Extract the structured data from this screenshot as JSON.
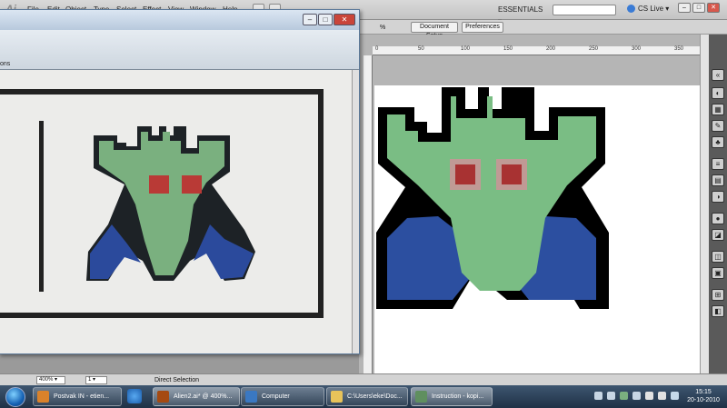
{
  "menubar": {
    "app_logo": "Ai",
    "items": [
      "File",
      "Edit",
      "Object",
      "Type",
      "Select",
      "Effect",
      "View",
      "Window",
      "Help"
    ],
    "workspace": "ESSENTIALS",
    "cs_live": "CS Live"
  },
  "control_bar": {
    "percent_label": "%",
    "document_setup": "Document Setup",
    "preferences": "Preferences"
  },
  "ruler": {
    "ticks": [
      "0",
      "50",
      "100",
      "150",
      "200",
      "250",
      "300",
      "350"
    ]
  },
  "reference_window": {
    "toolbar_label": "ons",
    "close_label": "✕"
  },
  "status_bar": {
    "zoom": "400%",
    "artboard_number": "1",
    "tool": "Direct Selection"
  },
  "taskbar": {
    "tasks": [
      {
        "label": "Postvak IN - etien...",
        "color": "#d9822b"
      },
      {
        "label": "Alien2.ai* @ 400%...",
        "color": "#a54a12"
      },
      {
        "label": "Computer",
        "color": "#3a78c2"
      },
      {
        "label": "C:\\Users\\eke\\Doc...",
        "color": "#e8c35a"
      },
      {
        "label": "Instruction - kopi...",
        "color": "#5f8f5f"
      }
    ],
    "clock_time": "15:15",
    "clock_date": "20-10-2010"
  },
  "colors": {
    "alien_body": "#7abd84",
    "alien_outline": "#000000",
    "alien_legs": "#2c4fa0",
    "alien_eyes": "#a83232",
    "alien_eye_rim": "#c09a95"
  }
}
